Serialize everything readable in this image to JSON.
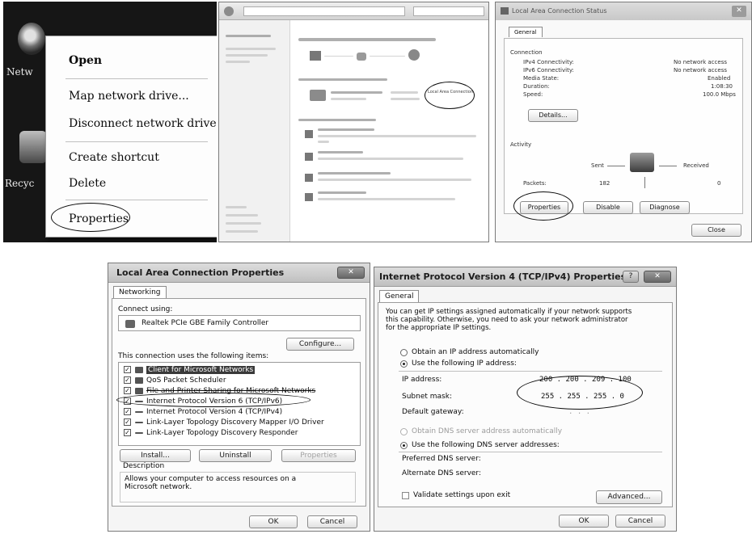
{
  "context_menu": {
    "items": [
      "Open",
      "Map network drive...",
      "Disconnect network drive...",
      "Create shortcut",
      "Delete",
      "Properties"
    ]
  },
  "desktop": {
    "icons": [
      "Netw",
      "Recyc"
    ]
  },
  "network_center": {
    "link_highlighted": "Local Area Connection"
  },
  "status_window": {
    "title": "Local Area Connection Status",
    "tab": "General",
    "section_connection": "Connection",
    "rows": [
      {
        "label": "IPv4 Connectivity:",
        "value": "No network access"
      },
      {
        "label": "IPv6 Connectivity:",
        "value": "No network access"
      },
      {
        "label": "Media State:",
        "value": "Enabled"
      },
      {
        "label": "Duration:",
        "value": "1:08:30"
      },
      {
        "label": "Speed:",
        "value": "100.0 Mbps"
      }
    ],
    "details_button": "Details...",
    "section_activity": "Activity",
    "sent_label": "Sent",
    "received_label": "Received",
    "packets_label": "Packets:",
    "packets_sent": "182",
    "packets_received": "0",
    "properties_button": "Properties",
    "disable_button": "Disable",
    "diagnose_button": "Diagnose",
    "close_button": "Close"
  },
  "lan_props": {
    "title": "Local Area Connection Properties",
    "tab": "Networking",
    "connect_using_label": "Connect using:",
    "adapter": "Realtek PCIe GBE Family Controller",
    "configure_button": "Configure...",
    "items_label": "This connection uses the following items:",
    "items": [
      "Client for Microsoft Networks",
      "QoS Packet Scheduler",
      "File and Printer Sharing for Microsoft Networks",
      "Internet Protocol Version 6 (TCP/IPv6)",
      "Internet Protocol Version 4 (TCP/IPv4)",
      "Link-Layer Topology Discovery Mapper I/O Driver",
      "Link-Layer Topology Discovery Responder"
    ],
    "install_button": "Install...",
    "uninstall_button": "Uninstall",
    "properties_button": "Properties",
    "description_label": "Description",
    "description_text": "Allows your computer to access resources on a Microsoft network.",
    "ok_button": "OK",
    "cancel_button": "Cancel"
  },
  "ipv4_props": {
    "title": "Internet Protocol Version 4 (TCP/IPv4) Properties",
    "tab": "General",
    "intro": [
      "You can get IP settings assigned automatically if your network supports",
      "this capability. Otherwise, you need to ask your network administrator",
      "for the appropriate IP settings."
    ],
    "radio_auto_ip": "Obtain an IP address automatically",
    "radio_static_ip": "Use the following IP address:",
    "ip_label": "IP address:",
    "ip_value": "200 . 200 . 209 . 100",
    "mask_label": "Subnet mask:",
    "mask_value": "255 . 255 . 255 . 0",
    "gateway_label": "Default gateway:",
    "gateway_value": ". . .",
    "radio_auto_dns": "Obtain DNS server address automatically",
    "radio_static_dns": "Use the following DNS server addresses:",
    "preferred_dns_label": "Preferred DNS server:",
    "alternate_dns_label": "Alternate DNS server:",
    "validate_label": "Validate settings upon exit",
    "advanced_button": "Advanced...",
    "ok_button": "OK",
    "cancel_button": "Cancel"
  }
}
